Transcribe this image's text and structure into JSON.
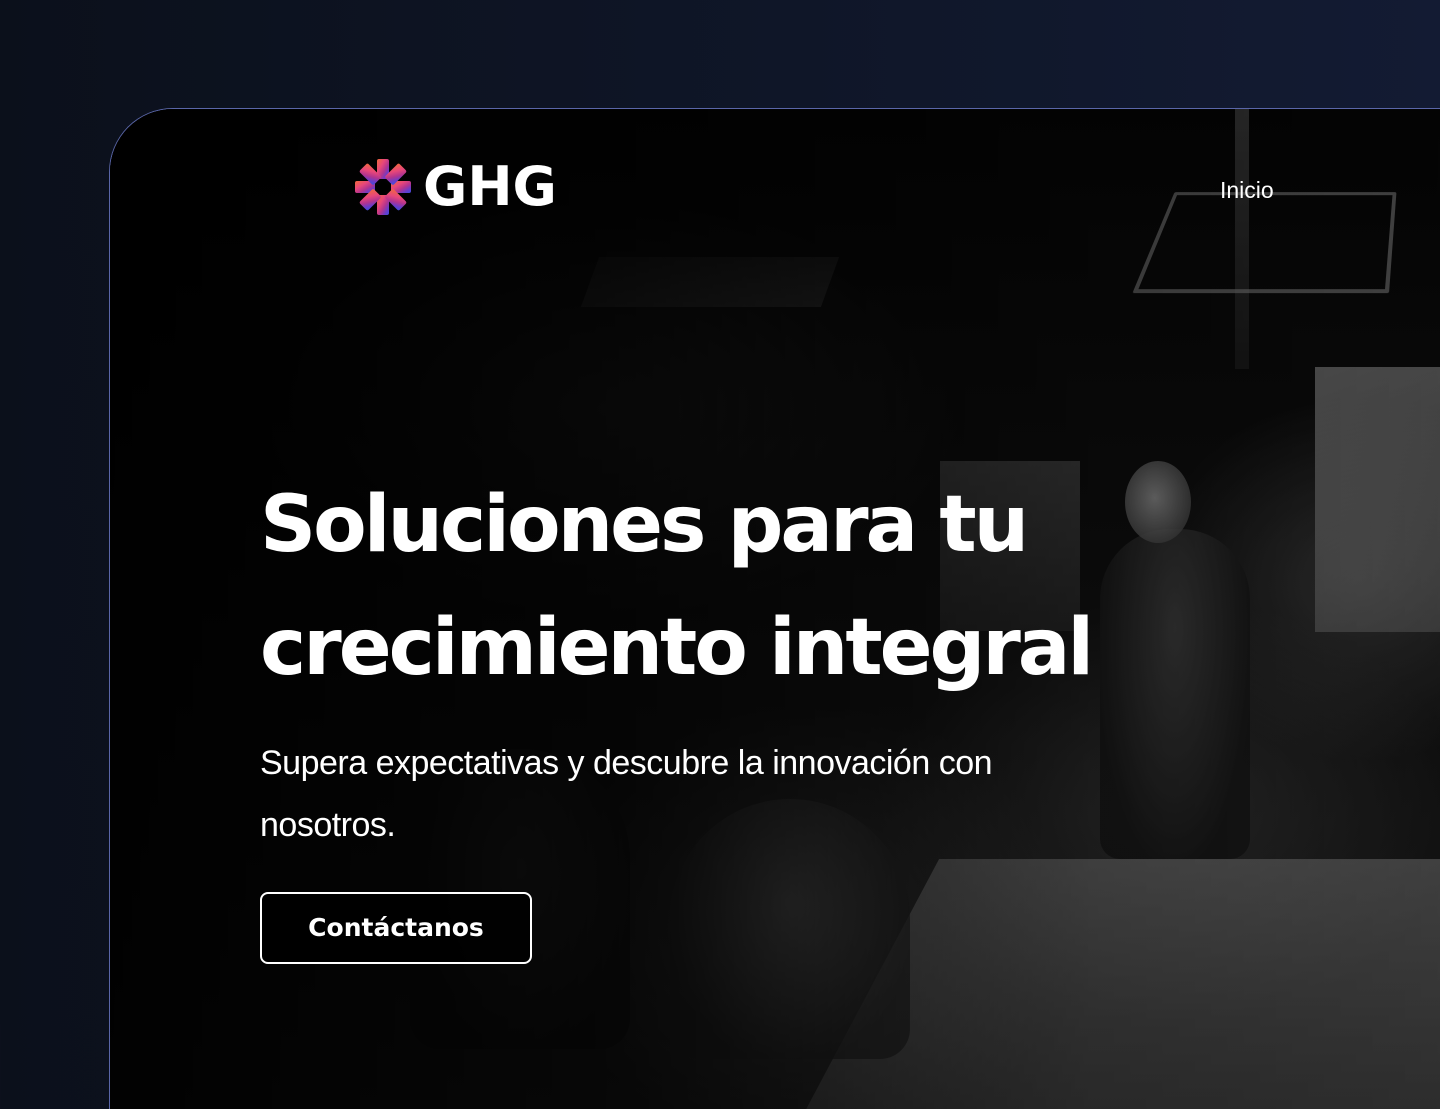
{
  "brand": {
    "name": "GHG",
    "logo_icon": "starburst-logo-icon",
    "logo_colors": [
      "#f06a3c",
      "#e8477a",
      "#b2348f",
      "#6b3cc9",
      "#3b4ee0"
    ]
  },
  "nav": {
    "items": [
      {
        "label": "Inicio"
      }
    ]
  },
  "hero": {
    "title_line1": "Soluciones para tu",
    "title_line2": "crecimiento integral",
    "subtitle": "Supera expectativas y descubre la innovación con nosotros.",
    "cta_label": "Contáctanos"
  },
  "colors": {
    "page_background": "#0f1628",
    "frame_border": "#5a66a8",
    "text": "#ffffff"
  }
}
